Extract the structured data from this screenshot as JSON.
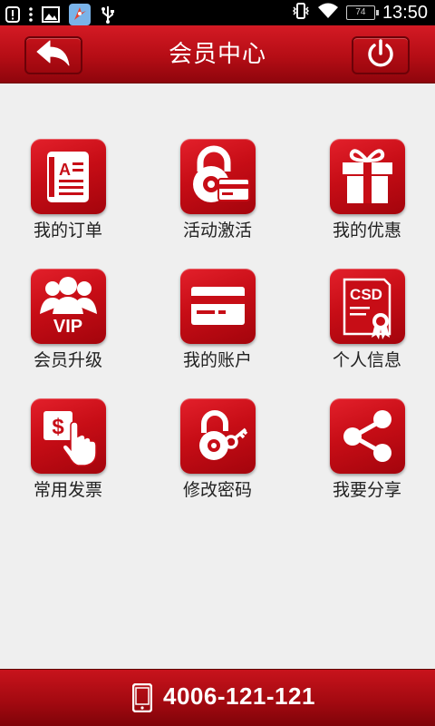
{
  "status_bar": {
    "battery": "74",
    "time": "13:50",
    "icons": [
      "notification-icon",
      "more-icon",
      "image-icon",
      "app-icon",
      "usb-icon",
      "vibrate-icon",
      "wifi-icon",
      "battery-icon"
    ]
  },
  "header": {
    "title": "会员中心",
    "back_icon": "back-arrow-icon",
    "power_icon": "power-icon"
  },
  "grid": {
    "items": [
      {
        "label": "我的订单",
        "icon": "order-book-icon"
      },
      {
        "label": "活动激活",
        "icon": "lock-card-icon"
      },
      {
        "label": "我的优惠",
        "icon": "gift-icon"
      },
      {
        "label": "会员升级",
        "icon": "vip-icon"
      },
      {
        "label": "我的账户",
        "icon": "bank-card-icon"
      },
      {
        "label": "个人信息",
        "icon": "certificate-icon"
      },
      {
        "label": "常用发票",
        "icon": "invoice-icon"
      },
      {
        "label": "修改密码",
        "icon": "lock-key-icon"
      },
      {
        "label": "我要分享",
        "icon": "share-icon"
      }
    ]
  },
  "icon_texts": {
    "vip": "VIP",
    "csd": "CSD",
    "dollar": "$"
  },
  "footer": {
    "phone": "4006-121-121",
    "icon": "phone-icon"
  },
  "colors": {
    "accent": "#c70d16",
    "background": "#efefef"
  }
}
